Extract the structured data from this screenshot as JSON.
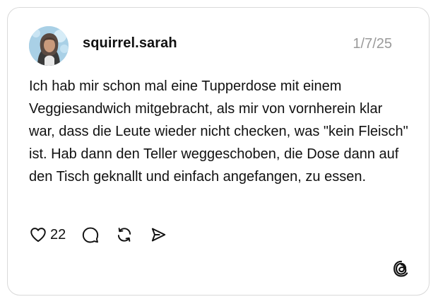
{
  "post": {
    "username": "squirrel.sarah",
    "date": "1/7/25",
    "text": "Ich hab mir schon mal eine Tupperdose mit einem Veggiesandwich mitgebracht, als mir von vornherein klar war, dass die Leute wieder nicht checken, was \"kein Fleisch\" ist. Hab dann den Teller weggeschoben, die Dose dann auf den Tisch geknallt und einfach angefangen, zu essen.",
    "likes": "22"
  },
  "icons": {
    "like": "heart-icon",
    "reply": "comment-icon",
    "repost": "repost-icon",
    "share": "send-icon",
    "brand": "threads-logo-icon"
  },
  "colors": {
    "text": "#111111",
    "muted": "#9a9a9a",
    "border": "#d9d9d9"
  }
}
